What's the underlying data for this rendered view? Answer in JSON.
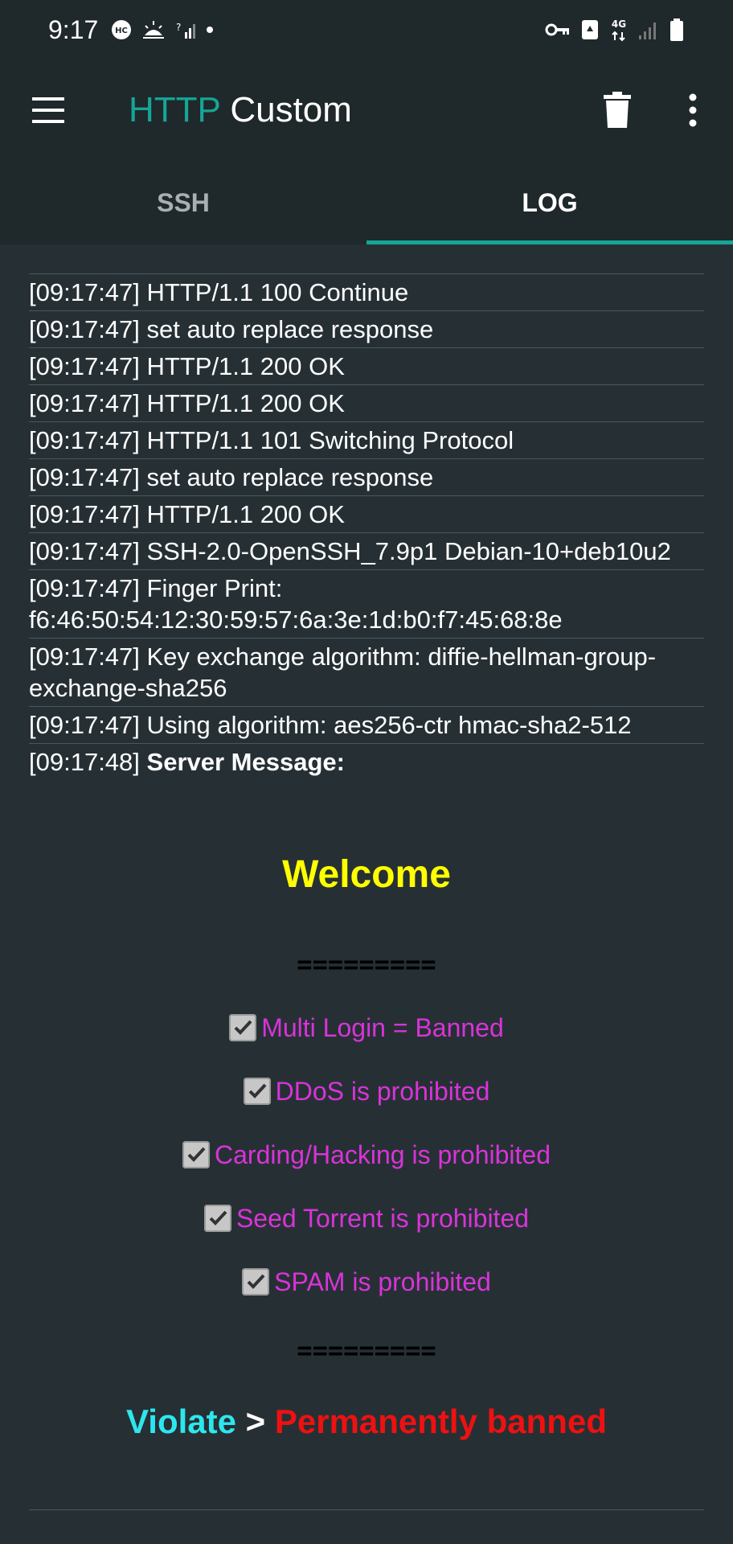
{
  "status_bar": {
    "time": "9:17",
    "network": "4G",
    "icons": [
      "hc-icon",
      "weather-icon",
      "signal-icon",
      "dot-icon",
      "vpn-key-icon",
      "recycle-icon",
      "network-icon",
      "signal-bars-icon",
      "battery-icon"
    ]
  },
  "app_bar": {
    "title_part1": "HTTP",
    "title_part2": "Custom",
    "colors": {
      "accent": "#16a595",
      "bar": "#1f282b",
      "background": "#263034"
    }
  },
  "tabs": [
    {
      "label": "SSH",
      "active": false
    },
    {
      "label": "LOG",
      "active": true
    }
  ],
  "log": [
    {
      "text": "[09:17:47] HTTP/1.1 100 Continue"
    },
    {
      "text": "[09:17:47] set auto replace response"
    },
    {
      "text": "[09:17:47] HTTP/1.1 200 OK"
    },
    {
      "text": "[09:17:47] HTTP/1.1 200 OK"
    },
    {
      "text": "[09:17:47] HTTP/1.1 101 Switching Protocol"
    },
    {
      "text": "[09:17:47] set auto replace response"
    },
    {
      "text": "[09:17:47] HTTP/1.1 200 OK"
    },
    {
      "text": "[09:17:47] SSH-2.0-OpenSSH_7.9p1 Debian-10+deb10u2"
    },
    {
      "text": "[09:17:47] Finger Print: f6:46:50:54:12:30:59:57:6a:3e:1d:b0:f7:45:68:8e"
    },
    {
      "text": "[09:17:47] Key exchange algorithm: diffie-hellman-group-exchange-sha256"
    },
    {
      "text": "[09:17:47] Using algorithm: aes256-ctr hmac-sha2-512"
    },
    {
      "text": "[09:17:48]",
      "bold_text": "Server Message:"
    }
  ],
  "server_message": {
    "welcome": "Welcome",
    "divider": "=========",
    "rules": [
      "Multi Login = Banned",
      "DDoS is prohibited",
      "Carding/Hacking is prohibited",
      "Seed Torrent is prohibited",
      "SPAM is prohibited"
    ],
    "violate": "Violate",
    "separator": ">",
    "consequence": "Permanently banned",
    "colors": {
      "welcome": "#ffff00",
      "rules": "#d933d9",
      "violate": "#2ee6ee",
      "consequence": "#ee1111"
    }
  }
}
